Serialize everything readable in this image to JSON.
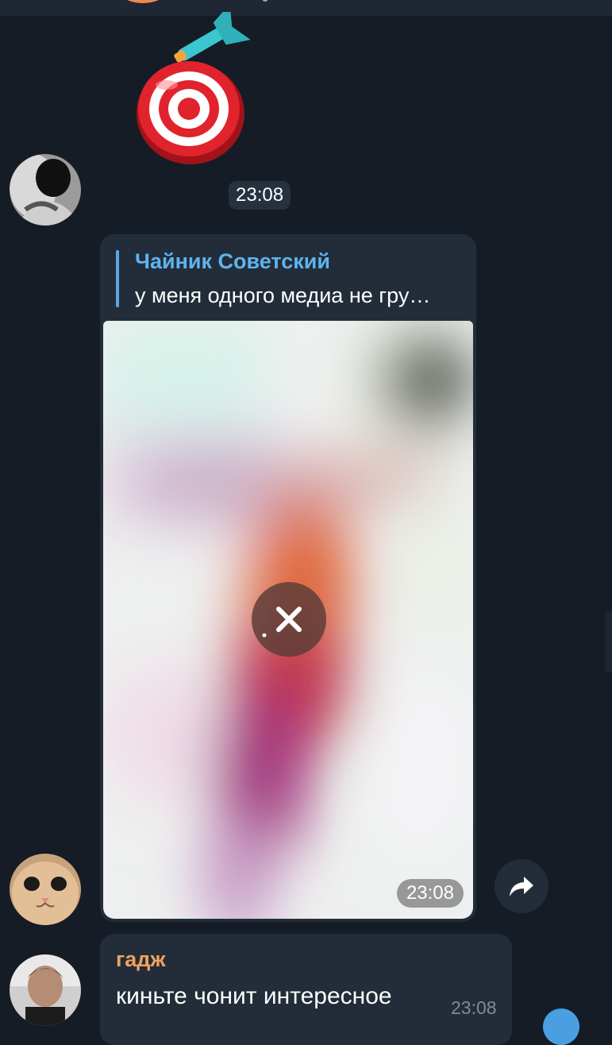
{
  "sticker": {
    "name": "dart-target-sticker",
    "time": "23:08"
  },
  "reply_message": {
    "reply_to_name": "Чайник Советский",
    "reply_to_text": "у меня одного медиа не гру…",
    "media_time": "23:08"
  },
  "message2": {
    "sender": "гадж",
    "text": "киньте чонит интересное",
    "time": "23:08"
  },
  "colors": {
    "background": "#151c25",
    "bubble": "#222d39",
    "reply_accent": "#5aa7e6",
    "sender_name": "#f0a15f"
  },
  "icons": {
    "cancel": "close-icon",
    "forward": "forward-arrow-icon"
  }
}
